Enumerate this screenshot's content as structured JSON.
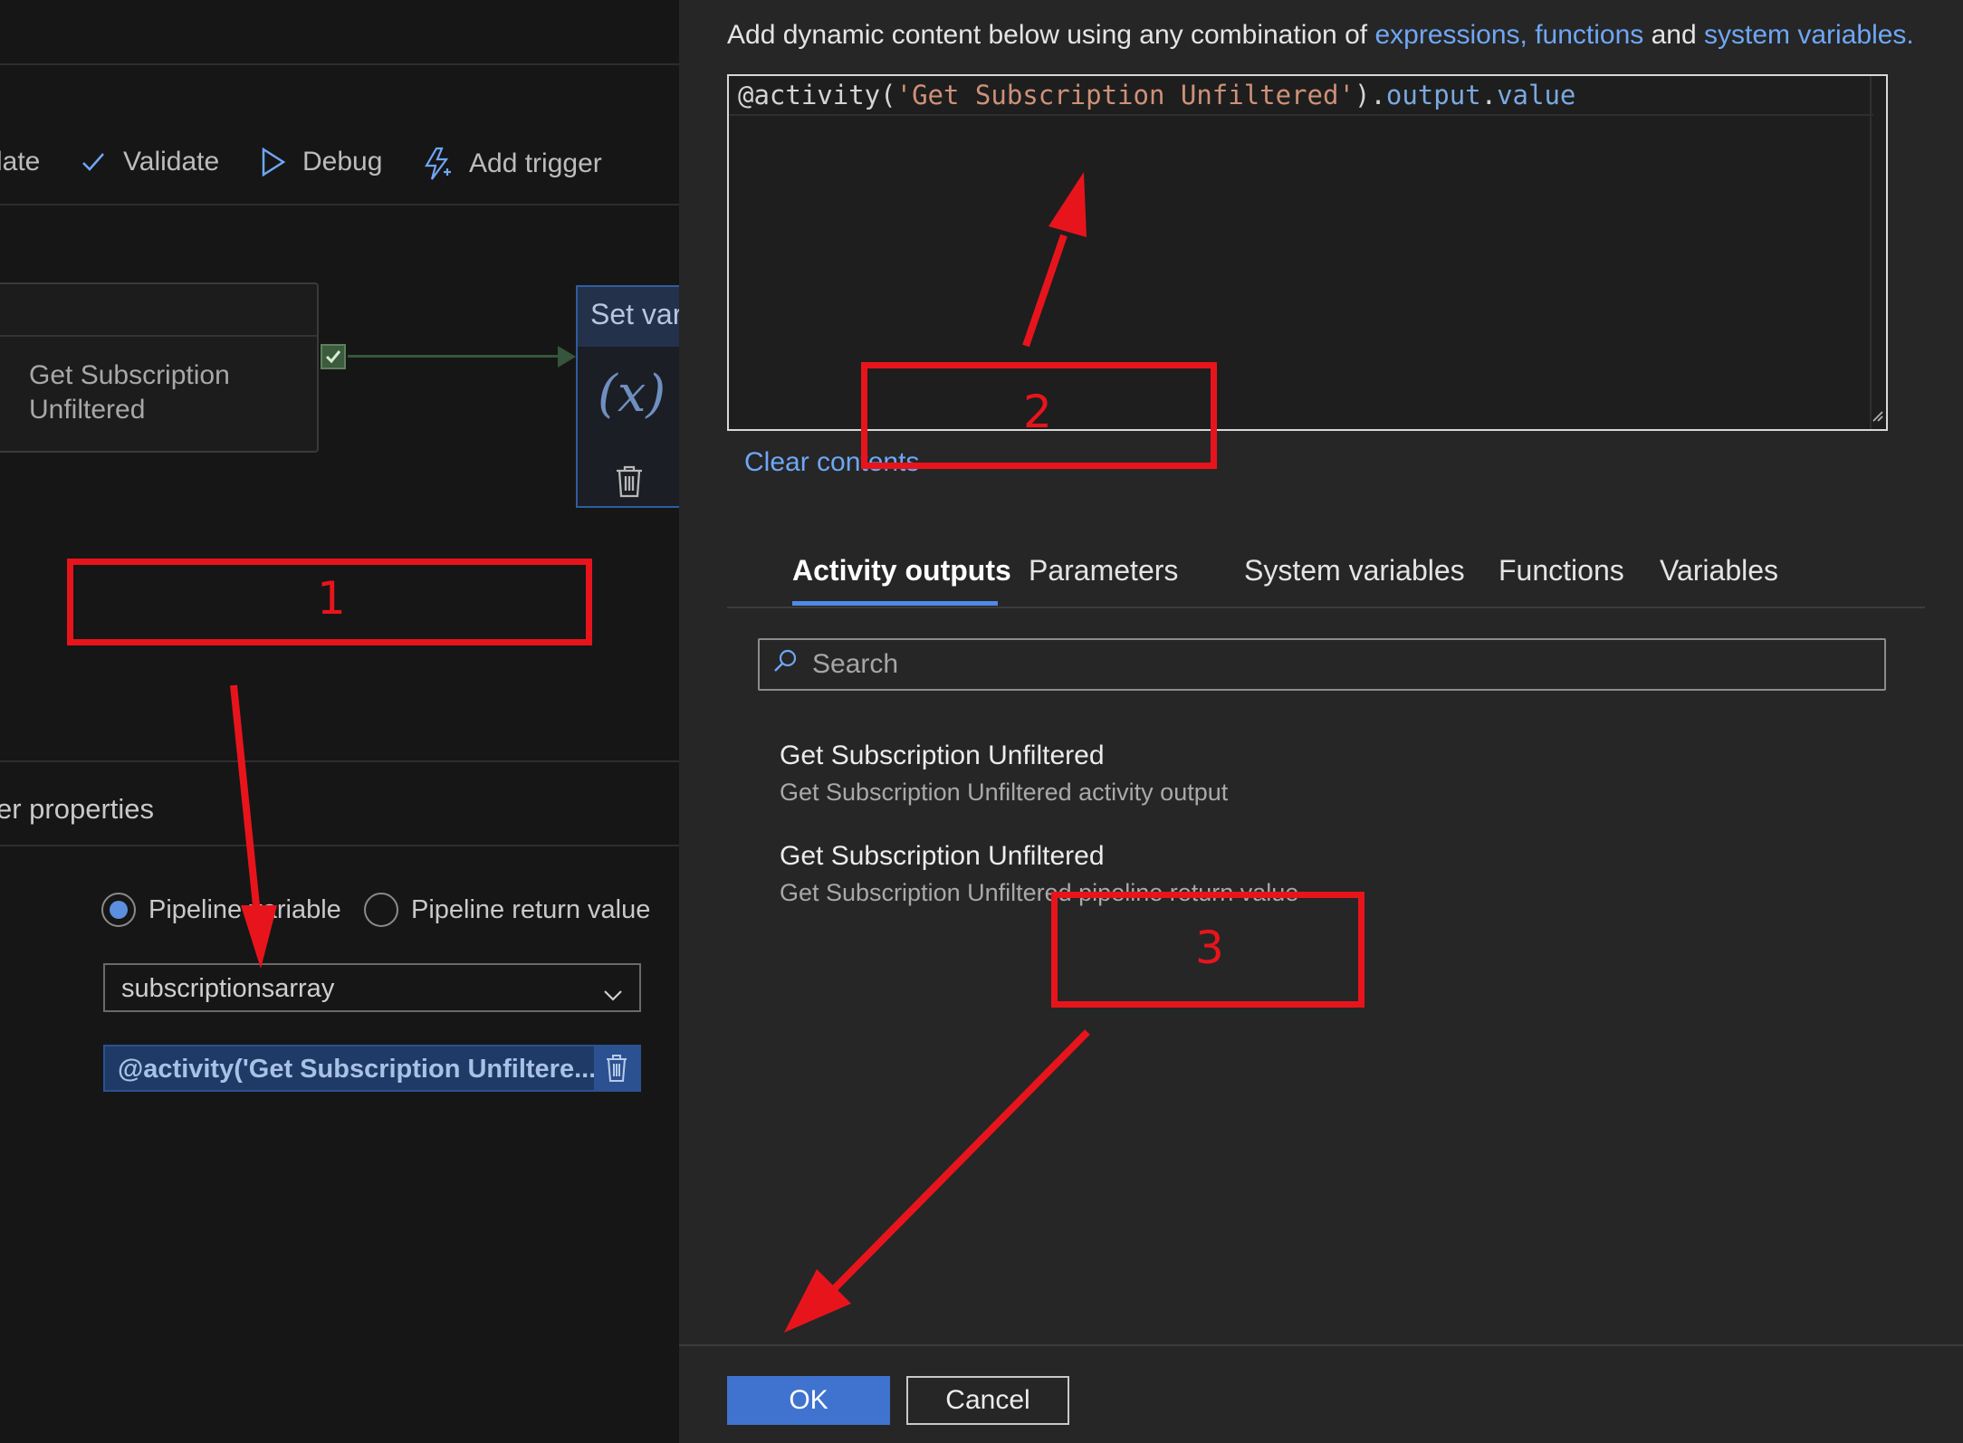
{
  "left_pane": {
    "toolbar": {
      "partial_label": "late",
      "validate_label": "Validate",
      "debug_label": "Debug",
      "add_trigger_label": "Add trigger"
    },
    "activity_card": {
      "name": "Get Subscription Unfiltered"
    },
    "set_variable_card": {
      "title": "Set vari",
      "fx_symbol": "(x)"
    },
    "properties": {
      "title": "er properties",
      "radio_pipeline_variable": "Pipeline variable",
      "radio_return_value": "Pipeline return value",
      "selected_radio": "Pipeline variable",
      "variable_dropdown_value": "subscriptionsarray",
      "value_expression": "@activity('Get Subscription Unfiltere..."
    }
  },
  "dialog": {
    "intro_text": "Add dynamic content below using any combination of",
    "intro_link_1": "expressions, functions",
    "intro_and": "and",
    "intro_link_2": "system variables.",
    "expression": {
      "at": "@",
      "fn": "activity(",
      "str": "'Get Subscription Unfiltered'",
      "close": ").",
      "prop1": "output",
      "dot": ".",
      "prop2": "value"
    },
    "clear_contents_label": "Clear contents",
    "tabs": [
      "Activity outputs",
      "Parameters",
      "System variables",
      "Functions",
      "Variables"
    ],
    "active_tab": "Activity outputs",
    "search_placeholder": "Search",
    "items": [
      {
        "title": "Get Subscription Unfiltered",
        "subtitle": "Get Subscription Unfiltered activity output"
      },
      {
        "title": "Get Subscription Unfiltered",
        "subtitle": "Get Subscription Unfiltered pipeline return value"
      }
    ],
    "ok_label": "OK",
    "cancel_label": "Cancel"
  },
  "annotations": {
    "label_1": "1",
    "label_2": "2",
    "label_3": "3",
    "color": "#e8141c"
  },
  "colors": {
    "accent": "#3f73cf",
    "link": "#6fa7f5",
    "dialog_bg": "#262626",
    "canvas_bg": "#161616"
  }
}
